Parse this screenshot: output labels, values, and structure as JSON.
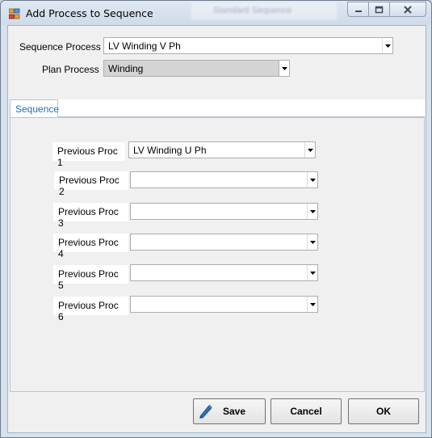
{
  "window": {
    "title": "Add Process to Sequence",
    "background_title": "Standard Sequence"
  },
  "form": {
    "sequence_process": {
      "label": "Sequence Process",
      "value": "LV Winding V Ph"
    },
    "plan_process": {
      "label": "Plan Process",
      "value": "Winding"
    }
  },
  "tabs": [
    {
      "label": "Sequence",
      "selected": true
    }
  ],
  "previous": [
    {
      "label": "Previous Proc 1",
      "value": "LV Winding U Ph"
    },
    {
      "label": "Previous Proc 2",
      "value": ""
    },
    {
      "label": "Previous Proc 3",
      "value": ""
    },
    {
      "label": "Previous Proc 4",
      "value": ""
    },
    {
      "label": "Previous Proc 5",
      "value": ""
    },
    {
      "label": "Previous Proc 6",
      "value": ""
    }
  ],
  "buttons": {
    "save": "Save",
    "cancel": "Cancel",
    "ok": "OK"
  },
  "icons": {
    "app": "process-icon",
    "save": "pencil-icon",
    "minimize": "minimize-icon",
    "restore": "restore-icon",
    "close": "close-icon",
    "dropdown": "chevron-down-icon"
  },
  "colors": {
    "tab_text": "#1f6fbf",
    "save_icon": "#2c6fbf"
  }
}
